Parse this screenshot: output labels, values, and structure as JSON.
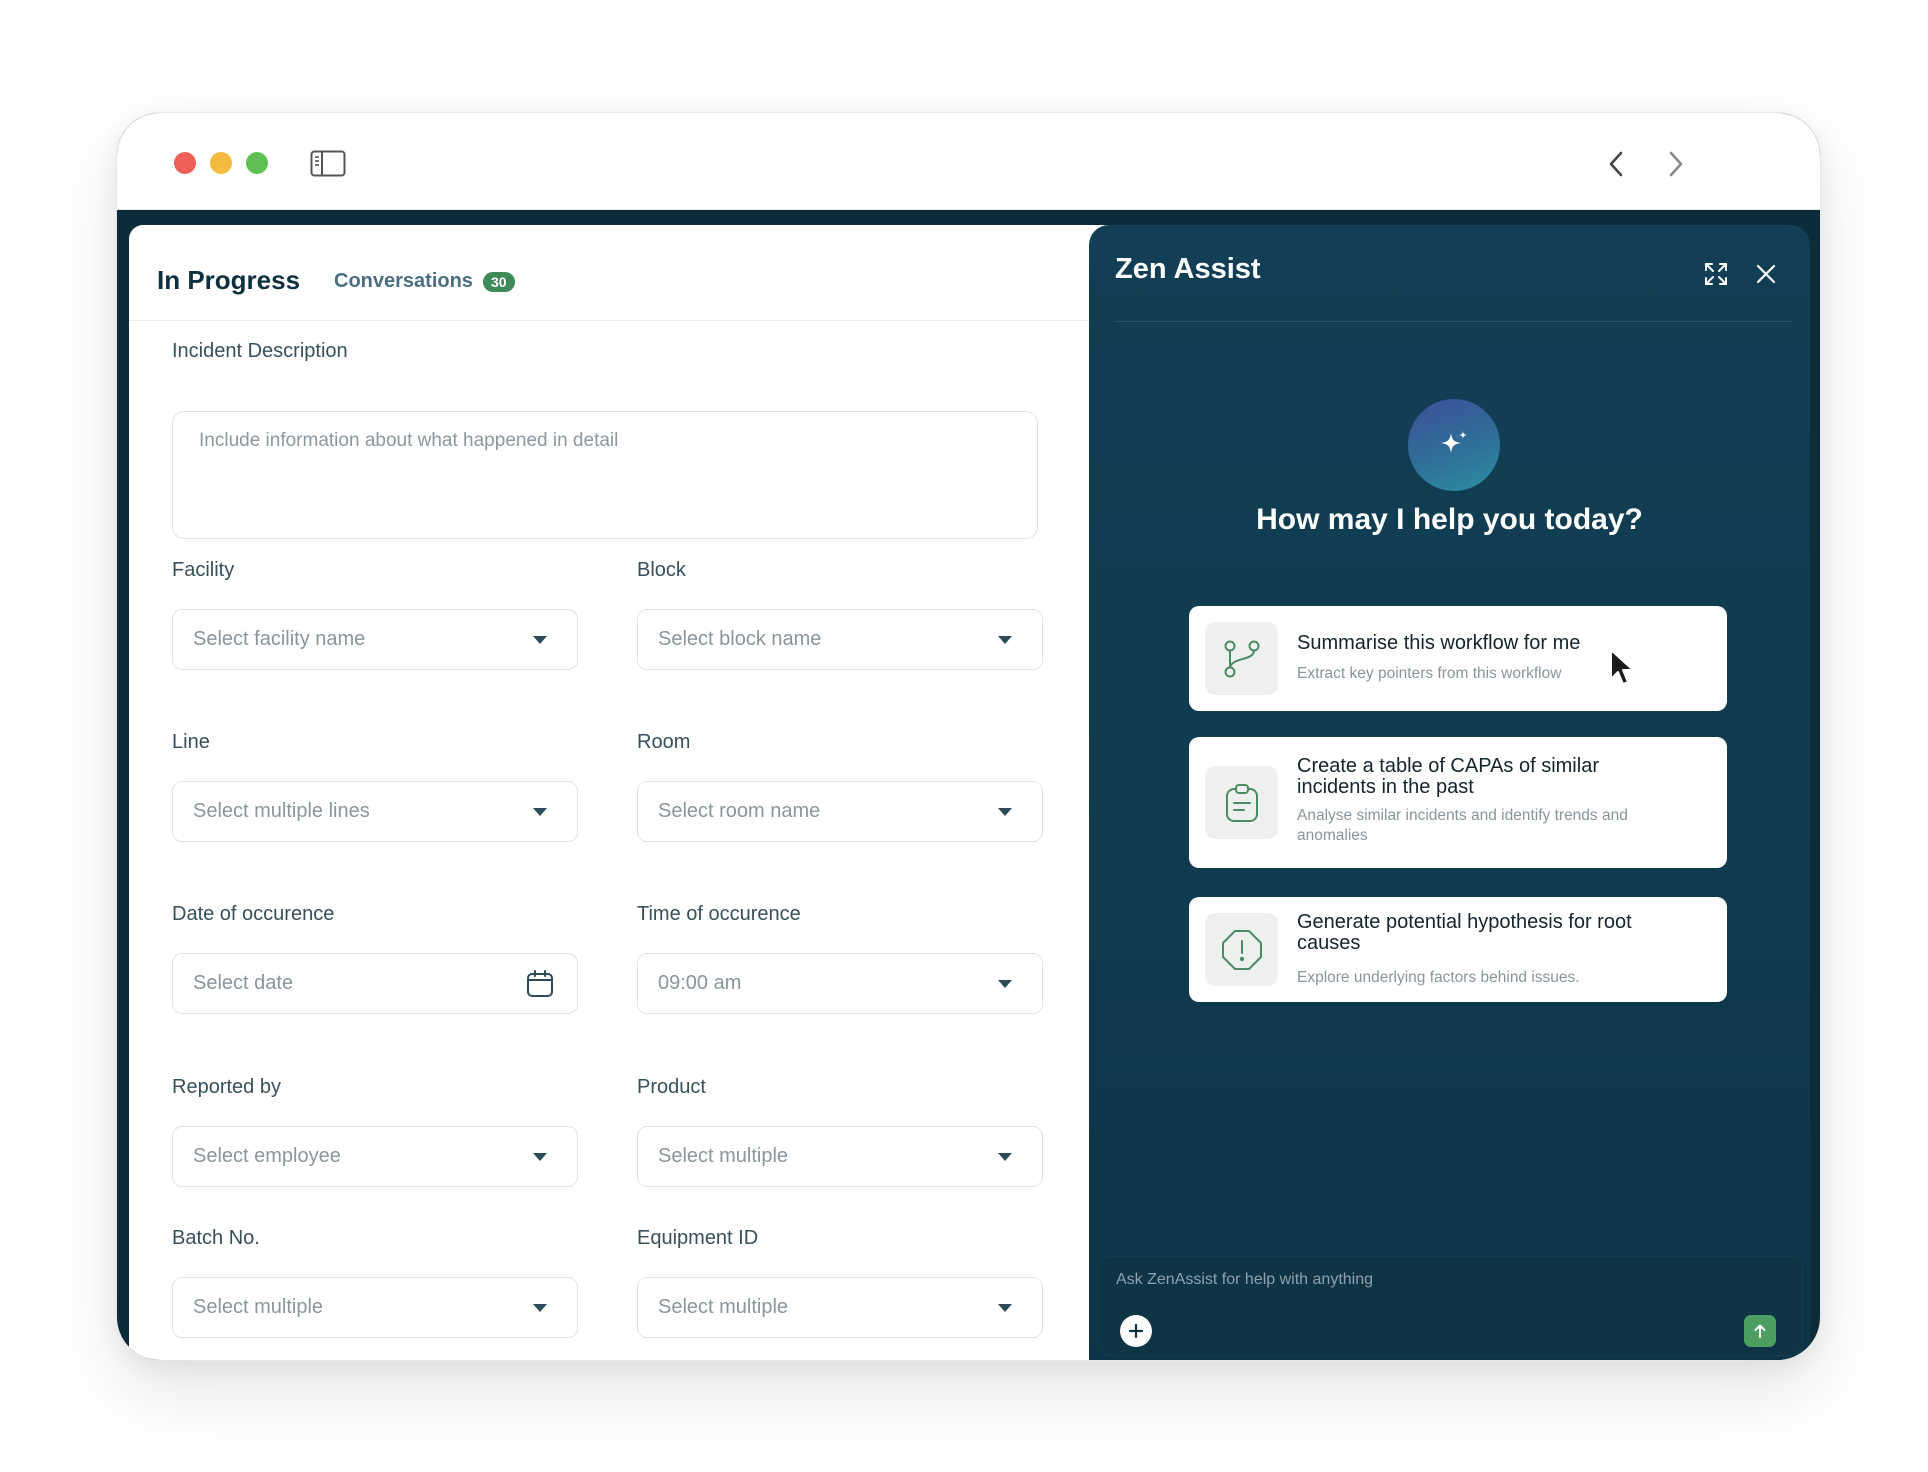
{
  "header": {
    "tab_active": "In Progress",
    "tab_conversations": "Conversations",
    "conversations_count": "30"
  },
  "form": {
    "incident": {
      "label": "Incident Description",
      "placeholder": "Include information about what happened in detail"
    },
    "facility": {
      "label": "Facility",
      "placeholder": "Select facility name"
    },
    "block": {
      "label": "Block",
      "placeholder": "Select block name"
    },
    "line": {
      "label": "Line",
      "placeholder": "Select multiple lines"
    },
    "room": {
      "label": "Room",
      "placeholder": "Select room name"
    },
    "date": {
      "label": "Date of occurence",
      "placeholder": "Select date"
    },
    "time": {
      "label": "Time of occurence",
      "value": "09:00 am"
    },
    "reported_by": {
      "label": "Reported by",
      "placeholder": "Select employee"
    },
    "product": {
      "label": "Product",
      "placeholder": "Select multiple"
    },
    "batch": {
      "label": "Batch No.",
      "placeholder": "Select multiple"
    },
    "equipment": {
      "label": "Equipment ID",
      "placeholder": "Select multiple"
    }
  },
  "assist": {
    "title": "Zen Assist",
    "heading": "How may I help you today?",
    "suggestions": [
      {
        "title": "Summarise this workflow for me",
        "subtitle": "Extract key pointers from this workflow",
        "icon": "git-branch-icon"
      },
      {
        "title": "Create a table of CAPAs of similar incidents in the past",
        "subtitle": "Analyse similar incidents and identify trends and anomalies",
        "icon": "clipboard-icon"
      },
      {
        "title": "Generate potential hypothesis for root causes",
        "subtitle": "Explore underlying factors behind issues.",
        "icon": "alert-octagon-icon"
      }
    ],
    "chat_placeholder": "Ask ZenAssist for help with anything"
  },
  "colors": {
    "window_dark": "#0d2c3a",
    "assist_bg": "#123f55",
    "accent_green": "#4d9e61",
    "badge_green": "#3e8b57"
  }
}
